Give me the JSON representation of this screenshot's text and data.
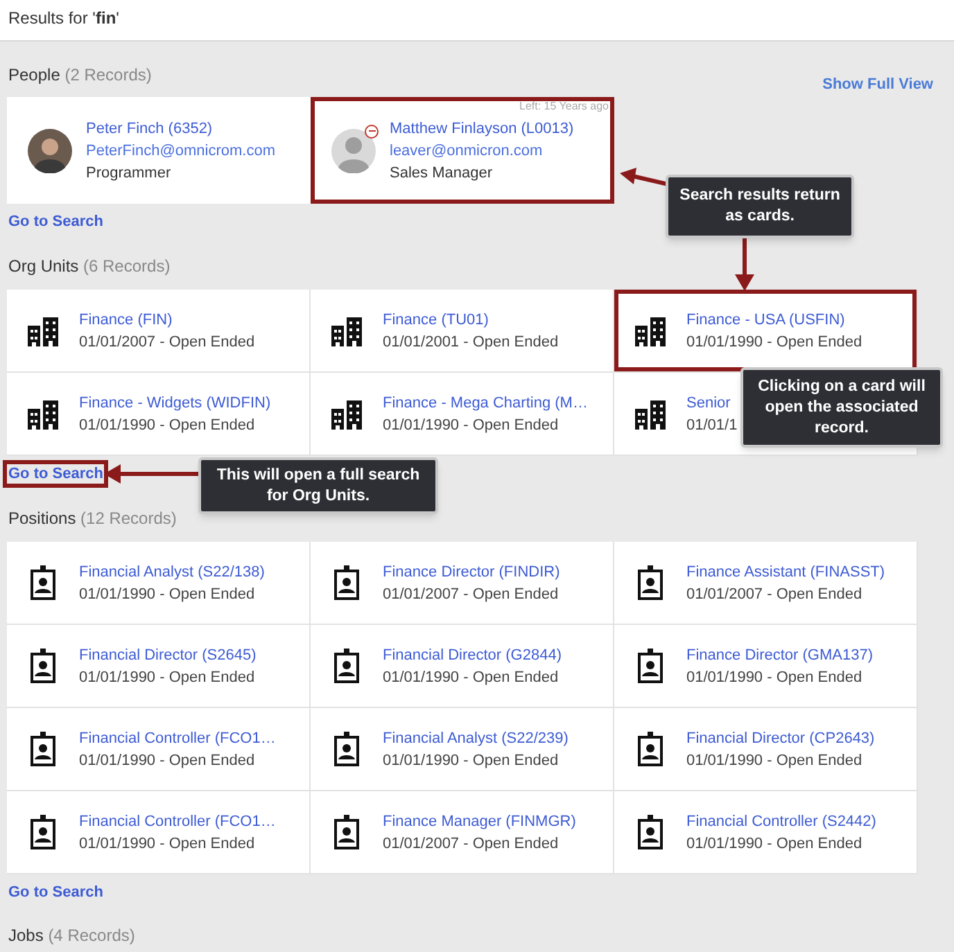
{
  "header": {
    "text": "Results for '**fin**'"
  },
  "sections": [
    {
      "kind": "people",
      "title": "People",
      "count": "(2 Records)",
      "action": "Show Full View",
      "link": "Go to Search",
      "link_highlighted": false,
      "cards": [
        {
          "name": "Peter Finch (6352)",
          "email": "PeterFinch@omnicrom.com",
          "role": "Programmer",
          "leaver": false,
          "highlighted": false
        },
        {
          "name": "Matthew Finlayson (L0013)",
          "email": "leaver@onmicron.com",
          "role": "Sales Manager",
          "leaver": true,
          "left_note": "Left: 15 Years ago",
          "highlighted": true
        }
      ]
    },
    {
      "kind": "org",
      "title": "Org Units",
      "count": "(6 Records)",
      "link": "Go to Search",
      "link_highlighted": true,
      "cards": [
        {
          "name": "Finance (FIN)",
          "dates": "01/01/2007 - Open Ended",
          "highlighted": false
        },
        {
          "name": "Finance (TU01)",
          "dates": "01/01/2001 - Open Ended",
          "highlighted": false
        },
        {
          "name": "Finance - USA (USFIN)",
          "dates": "01/01/1990 - Open Ended",
          "highlighted": true
        },
        {
          "name": "Finance - Widgets (WIDFIN)",
          "dates": "01/01/1990 - Open Ended",
          "highlighted": false
        },
        {
          "name": "Finance - Mega Charting (M…",
          "dates": "01/01/1990 - Open Ended",
          "highlighted": false
        },
        {
          "name": "Senior",
          "dates": "01/01/1",
          "highlighted": false
        }
      ]
    },
    {
      "kind": "positions",
      "title": "Positions",
      "count": "(12 Records)",
      "link": "Go to Search",
      "link_highlighted": false,
      "cards": [
        {
          "name": "Financial Analyst (S22/138)",
          "dates": "01/01/1990 - Open Ended",
          "highlighted": false
        },
        {
          "name": "Finance Director (FINDIR)",
          "dates": "01/01/2007 - Open Ended",
          "highlighted": false
        },
        {
          "name": "Finance Assistant (FINASST)",
          "dates": "01/01/2007 - Open Ended",
          "highlighted": false
        },
        {
          "name": "Financial Director (S2645)",
          "dates": "01/01/1990 - Open Ended",
          "highlighted": false
        },
        {
          "name": "Financial Director (G2844)",
          "dates": "01/01/1990 - Open Ended",
          "highlighted": false
        },
        {
          "name": "Finance Director (GMA137)",
          "dates": "01/01/1990 - Open Ended",
          "highlighted": false
        },
        {
          "name": "Financial Controller (FCO1…",
          "dates": "01/01/1990 - Open Ended",
          "highlighted": false
        },
        {
          "name": "Financial Analyst (S22/239)",
          "dates": "01/01/1990 - Open Ended",
          "highlighted": false
        },
        {
          "name": "Financial Director (CP2643)",
          "dates": "01/01/1990 - Open Ended",
          "highlighted": false
        },
        {
          "name": "Financial Controller (FCO1…",
          "dates": "01/01/1990 - Open Ended",
          "highlighted": false
        },
        {
          "name": "Finance Manager (FINMGR)",
          "dates": "01/01/2007 - Open Ended",
          "highlighted": false
        },
        {
          "name": "Financial Controller (S2442)",
          "dates": "01/01/1990 - Open Ended",
          "highlighted": false
        }
      ]
    },
    {
      "kind": "jobs",
      "title": "Jobs",
      "count": "(4 Records)"
    }
  ],
  "callouts": [
    {
      "text": "Search results return as cards."
    },
    {
      "text": "Clicking on a card will open the associated record."
    },
    {
      "text": "This will open a full search for Org Units."
    }
  ]
}
